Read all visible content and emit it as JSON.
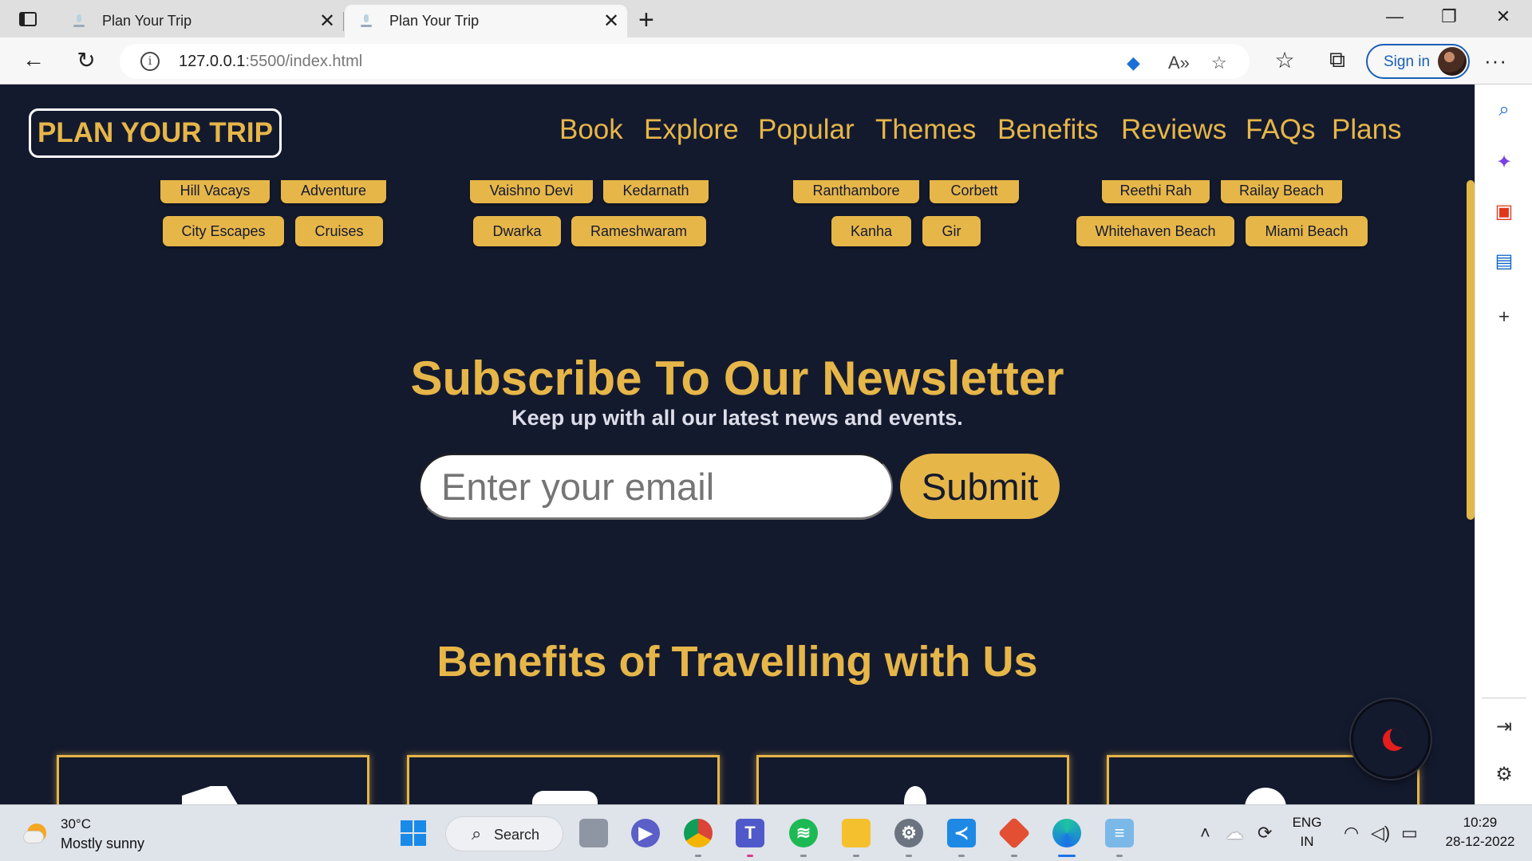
{
  "browser": {
    "tabs": [
      {
        "title": "Plan Your Trip",
        "active": false
      },
      {
        "title": "Plan Your Trip",
        "active": true
      }
    ],
    "url_host": "127.0.0.1",
    "url_path": ":5500/index.html",
    "sign_in": "Sign in"
  },
  "site": {
    "logo": "PLAN YOUR TRIP",
    "nav": [
      "Book",
      "Explore",
      "Popular",
      "Themes",
      "Benefits",
      "Reviews",
      "FAQs",
      "Plans"
    ],
    "accent_color": "#e6b649",
    "background_color": "#141a2e"
  },
  "tags": {
    "row1": [
      "Hill Vacays",
      "Adventure",
      "Vaishno Devi",
      "Kedarnath",
      "Ranthambore",
      "Corbett",
      "Reethi Rah",
      "Railay Beach"
    ],
    "row2": [
      "City Escapes",
      "Cruises",
      "Dwarka",
      "Rameshwaram",
      "Kanha",
      "Gir",
      "Whitehaven Beach",
      "Miami Beach"
    ]
  },
  "newsletter": {
    "title": "Subscribe To Our Newsletter",
    "subtitle": "Keep up with all our latest news and events.",
    "placeholder": "Enter your email",
    "submit": "Submit"
  },
  "benefits": {
    "title": "Benefits of Travelling with Us"
  },
  "taskbar": {
    "temperature": "30°C",
    "weather": "Mostly sunny",
    "search": "Search",
    "lang_top": "ENG",
    "lang_bottom": "IN",
    "time": "10:29",
    "date": "28-12-2022"
  }
}
